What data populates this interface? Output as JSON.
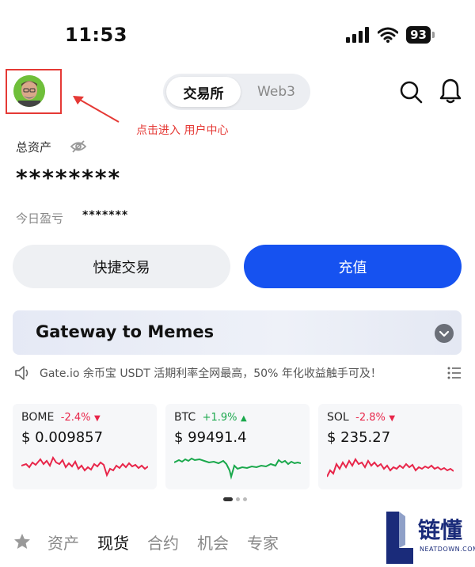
{
  "status_bar": {
    "time": "11:53",
    "battery": "93"
  },
  "header": {
    "tabs": [
      "交易所",
      "Web3"
    ],
    "annotation": "点击进入 用户中心"
  },
  "assets": {
    "label": "总资产",
    "value": "********",
    "pnl_label": "今日盈亏",
    "pnl_value": "*******"
  },
  "actions": {
    "quick_trade": "快捷交易",
    "deposit": "充值"
  },
  "banner": {
    "title": "Gateway to Memes"
  },
  "ticker": {
    "text": "Gate.io 余币宝 USDT 活期利率全网最高，50% 年化收益触手可及！"
  },
  "coins": [
    {
      "symbol": "BOME",
      "change": "-2.4%",
      "direction": "down",
      "price": "$ 0.009857",
      "color": "#e8264a"
    },
    {
      "symbol": "BTC",
      "change": "+1.9%",
      "direction": "up",
      "price": "$ 99491.4",
      "color": "#1aa84c"
    },
    {
      "symbol": "SOL",
      "change": "-2.8%",
      "direction": "down",
      "price": "$ 235.27",
      "color": "#e8264a"
    }
  ],
  "bottom_tabs": [
    "资产",
    "现货",
    "合约",
    "机会",
    "专家"
  ],
  "bottom_tabs_active": "现货",
  "watermark": {
    "title": "链懂",
    "sub": "NEATDOWN.COM"
  },
  "colors": {
    "primary": "#1652f0",
    "negative": "#e8264a",
    "positive": "#1aa84c",
    "annotation": "#e53935"
  }
}
